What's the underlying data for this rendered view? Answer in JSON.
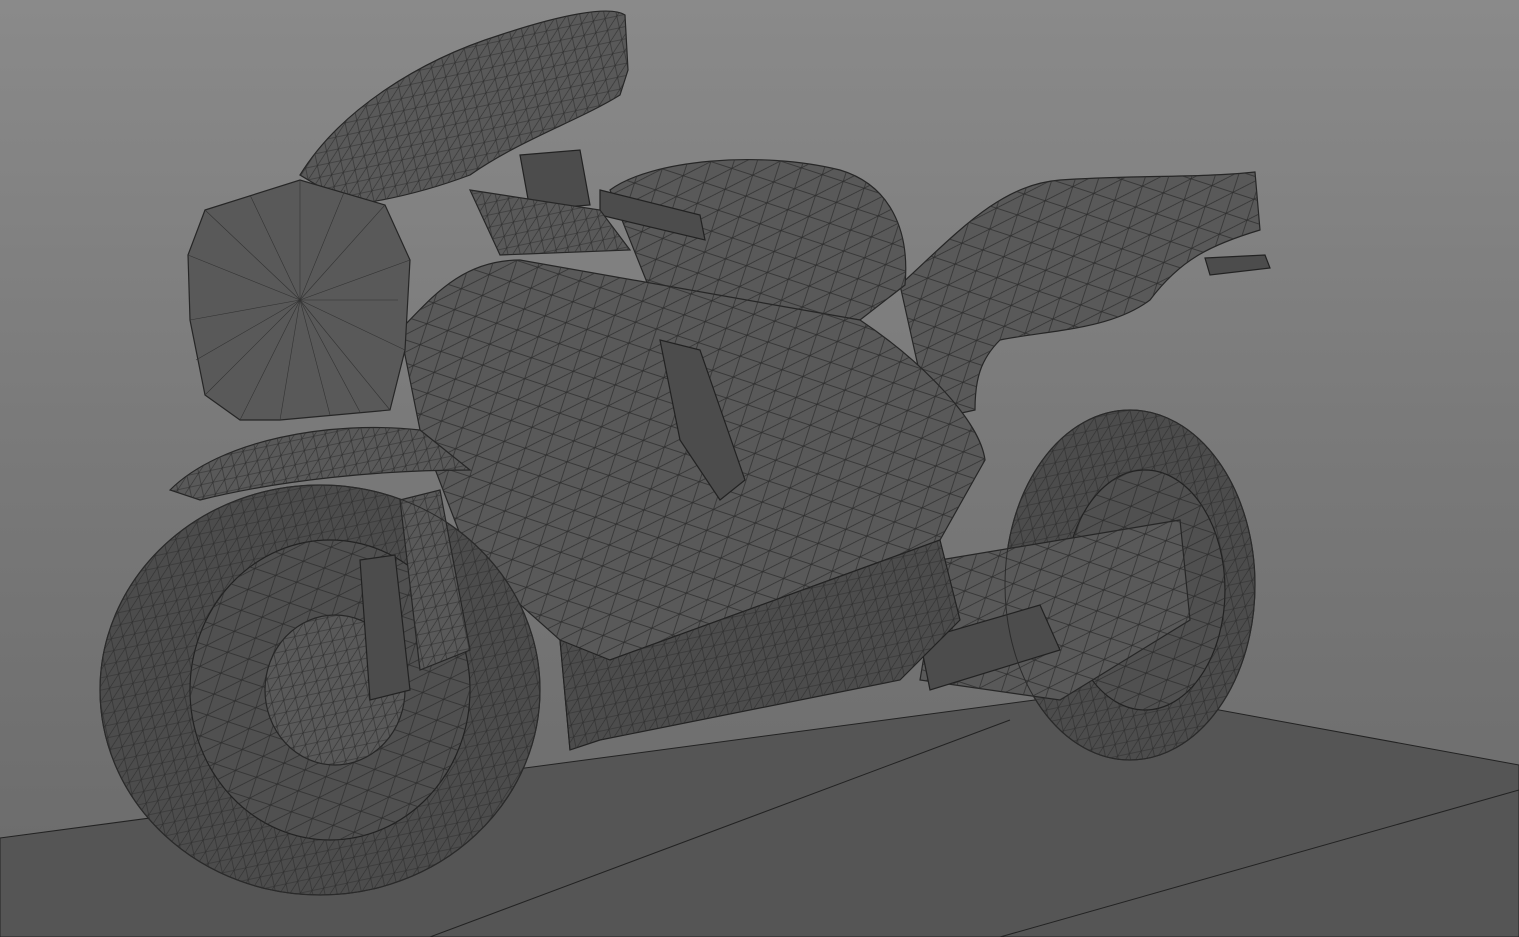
{
  "viewport": {
    "render_mode": "wireframe-on-shaded",
    "subject": "motorcycle mesh",
    "colors": {
      "background_top": "#8a8a8a",
      "background_bottom": "#6a6a6a",
      "floor": "#555555",
      "mesh_fill": "#595959",
      "wire": "#2b2b2b"
    }
  }
}
